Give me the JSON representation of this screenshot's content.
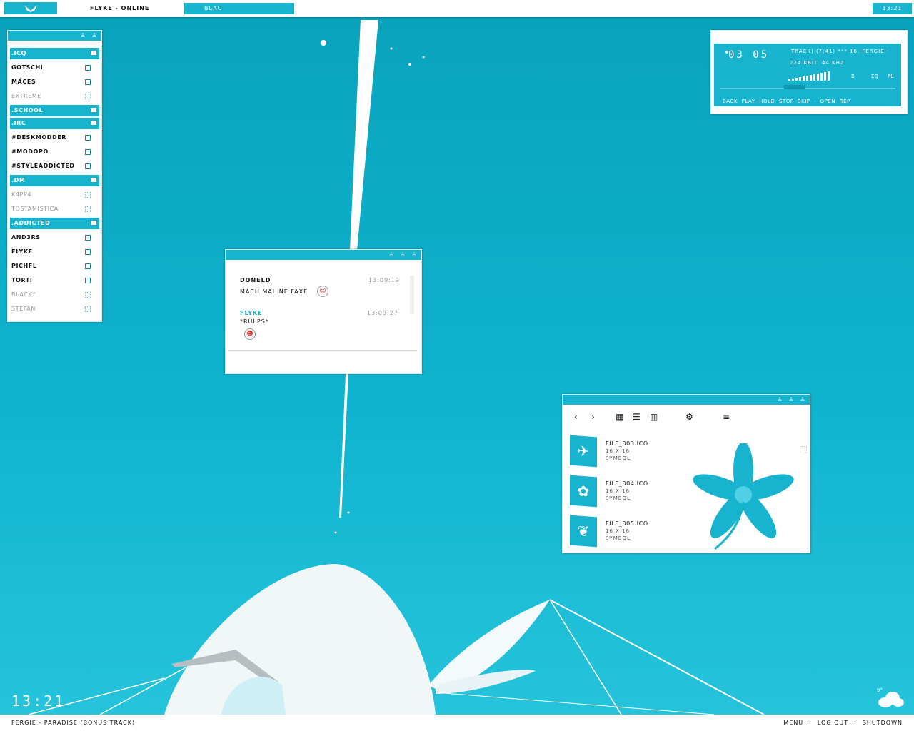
{
  "topbar": {
    "status": "FLYKE - ONLINE",
    "theme": "BLAU",
    "clock": "13:21"
  },
  "contacts": [
    {
      "kind": "group",
      "label": ".ICQ"
    },
    {
      "kind": "on",
      "label": "GOTSCHI"
    },
    {
      "kind": "on",
      "label": "MÄCES"
    },
    {
      "kind": "off",
      "label": "EXTREME"
    },
    {
      "kind": "group",
      "label": ".SCHOOL"
    },
    {
      "kind": "group",
      "label": ".IRC"
    },
    {
      "kind": "on",
      "label": "#DESKMODDER"
    },
    {
      "kind": "on",
      "label": "#MODOPO"
    },
    {
      "kind": "on",
      "label": "#STYLEADDICTED"
    },
    {
      "kind": "group",
      "label": ".DM"
    },
    {
      "kind": "off",
      "label": "K4PP4"
    },
    {
      "kind": "off",
      "label": "TOSTAMISTICA"
    },
    {
      "kind": "group",
      "label": ".ADDICTED"
    },
    {
      "kind": "on",
      "label": "AND3RS"
    },
    {
      "kind": "on",
      "label": "FLYKE"
    },
    {
      "kind": "on",
      "label": "PICHFL"
    },
    {
      "kind": "on",
      "label": "TORTI"
    },
    {
      "kind": "off",
      "label": "BLACKY"
    },
    {
      "kind": "off",
      "label": "STEFAN"
    }
  ],
  "player": {
    "time": "03 05",
    "track": "TRACK) (7:41)  ***  16. FERGIE -",
    "bitrate": "224 KBIT",
    "samplerate": "44 KHZ",
    "b": "B",
    "eq": "EQ",
    "pl": "PL",
    "controls": "BACK PLAY HOLD STOP SKIP · OPEN       REP",
    "volume_levels": [
      2,
      3,
      4,
      5,
      6,
      7,
      8,
      9,
      10,
      11,
      12,
      13
    ]
  },
  "chat": {
    "messages": [
      {
        "name": "DONELD",
        "time": "13:09:19",
        "text": "MACH MAL NE FAXE",
        "color": "#111111"
      },
      {
        "name": "FLYKE",
        "time": "13:09:27",
        "text": "*RÜLPS*",
        "color": "#17b3cf"
      }
    ]
  },
  "files": {
    "items": [
      {
        "name": "FILE_003.ICO",
        "size": "16 X 16",
        "type": "SYMBOL",
        "icon": "bird-icon",
        "glyph": "✈"
      },
      {
        "name": "FILE_004.ICO",
        "size": "16 X 16",
        "type": "SYMBOL",
        "icon": "leaf-icon",
        "glyph": "✿"
      },
      {
        "name": "FILE_005.ICO",
        "size": "16 X 16",
        "type": "SYMBOL",
        "icon": "plant-icon",
        "glyph": "❦"
      }
    ]
  },
  "bottom": {
    "clock": "13:21",
    "nowplaying": "FERGIE - PARADISE (BONUS TRACK)",
    "menu": "MENU",
    "logout": "LOG OUT",
    "shutdown": "SHUTDOWN",
    "sep": ":",
    "temp": "9°"
  },
  "colors": {
    "accent": "#17b3cf",
    "desktop": "#0eb4cf"
  }
}
